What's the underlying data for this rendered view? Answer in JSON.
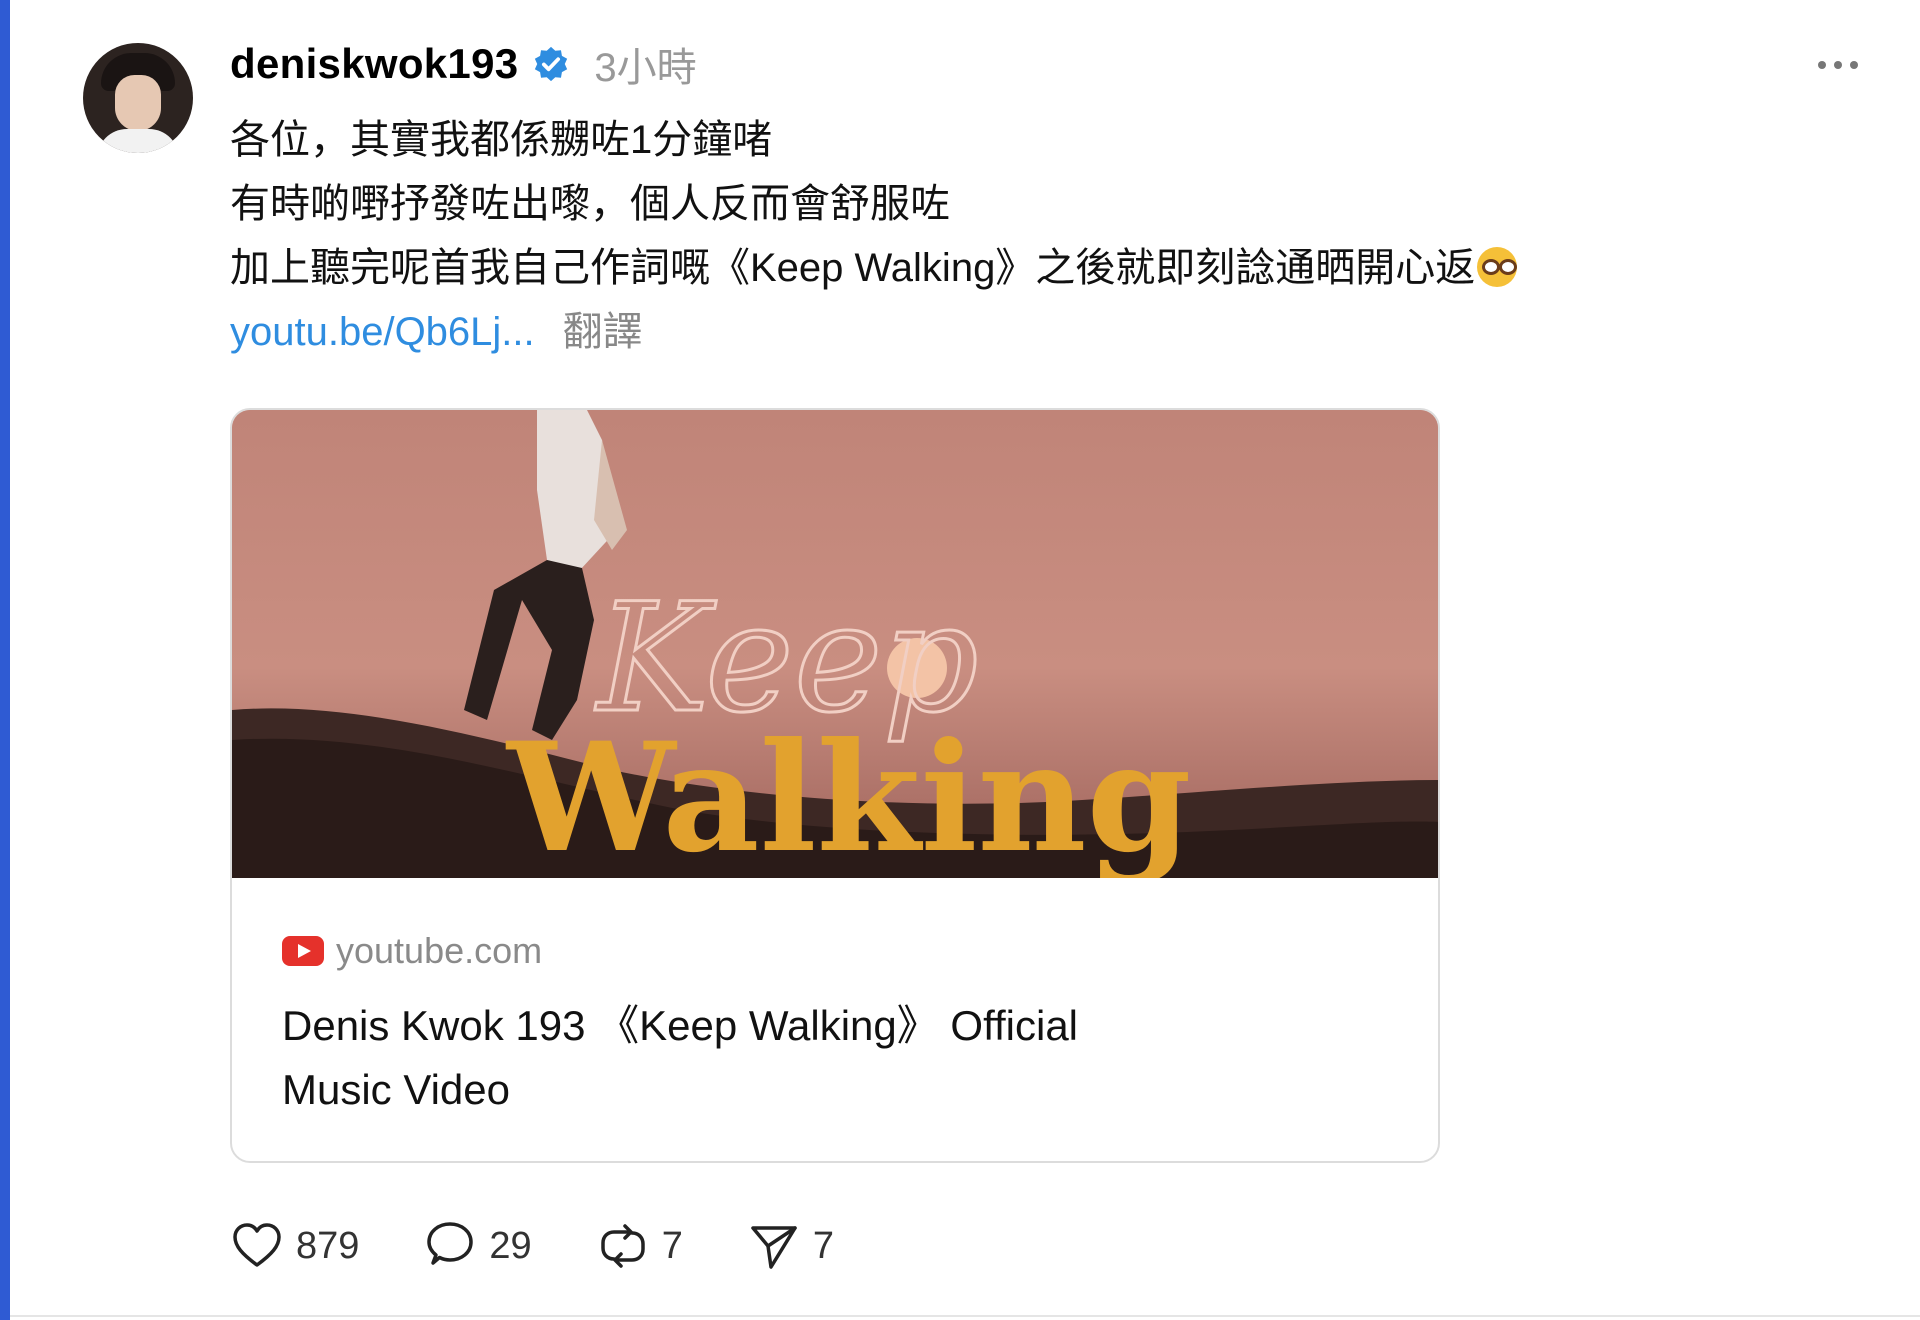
{
  "post": {
    "username": "deniskwok193",
    "time": "3小時",
    "lines": [
      "各位，其實我都係嬲咗1分鐘啫",
      "有時啲嘢抒發咗出嚟，個人反而會舒服咗",
      "加上聽完呢首我自己作詞嘅《Keep Walking》之後就即刻諗通晒開心返"
    ],
    "emoji": "nerd-face-icon",
    "link": "youtu.be/Qb6Lj...",
    "translate": "翻譯"
  },
  "card": {
    "source": "youtube.com",
    "title": "Denis Kwok 193 《Keep Walking》 Official Music Video",
    "thumb_title_script": "Keep",
    "thumb_title_main": "Walking"
  },
  "actions": {
    "likes": "879",
    "comments": "29",
    "reposts": "7",
    "shares": "7"
  },
  "colors": {
    "verified": "#2f8de0",
    "link": "#2f8de0",
    "accent_border": "#2f5bd3",
    "thumb_gold": "#e2a22e"
  }
}
